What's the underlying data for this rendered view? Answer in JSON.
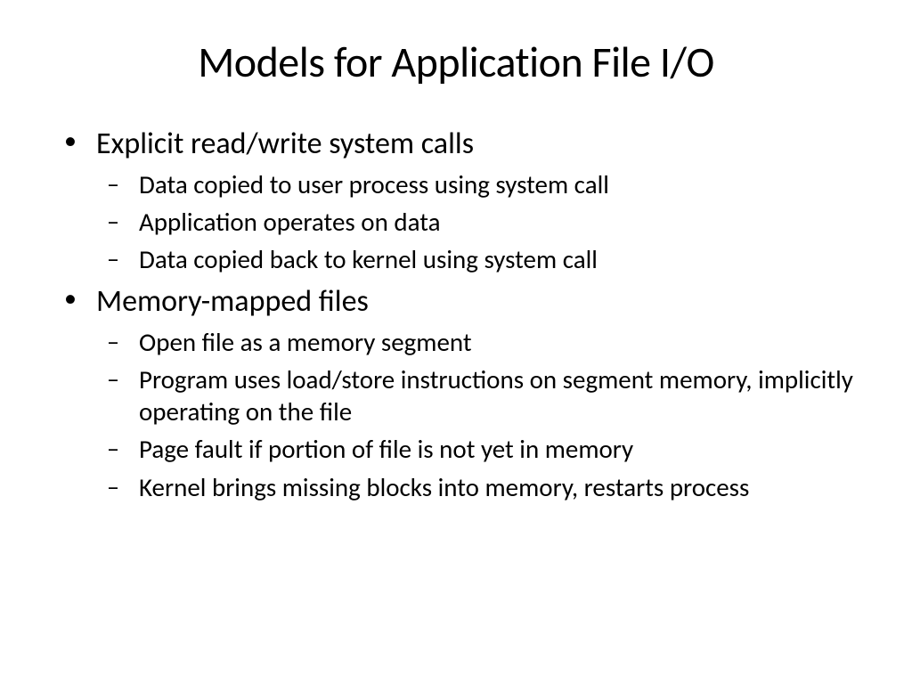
{
  "slide": {
    "title": "Models for Application File I/O",
    "bullets": [
      {
        "level": 1,
        "text": "Explicit read/write system calls"
      },
      {
        "level": 2,
        "text": "Data copied to user process using system call"
      },
      {
        "level": 2,
        "text": "Application operates on data"
      },
      {
        "level": 2,
        "text": "Data copied back to kernel using system call"
      },
      {
        "level": 1,
        "text": "Memory-mapped files"
      },
      {
        "level": 2,
        "text": "Open file as a memory segment"
      },
      {
        "level": 2,
        "text": "Program uses load/store instructions on segment memory, implicitly operating on the file"
      },
      {
        "level": 2,
        "text": "Page fault if portion of file is not yet in memory"
      },
      {
        "level": 2,
        "text": "Kernel brings missing blocks into memory, restarts process"
      }
    ]
  }
}
